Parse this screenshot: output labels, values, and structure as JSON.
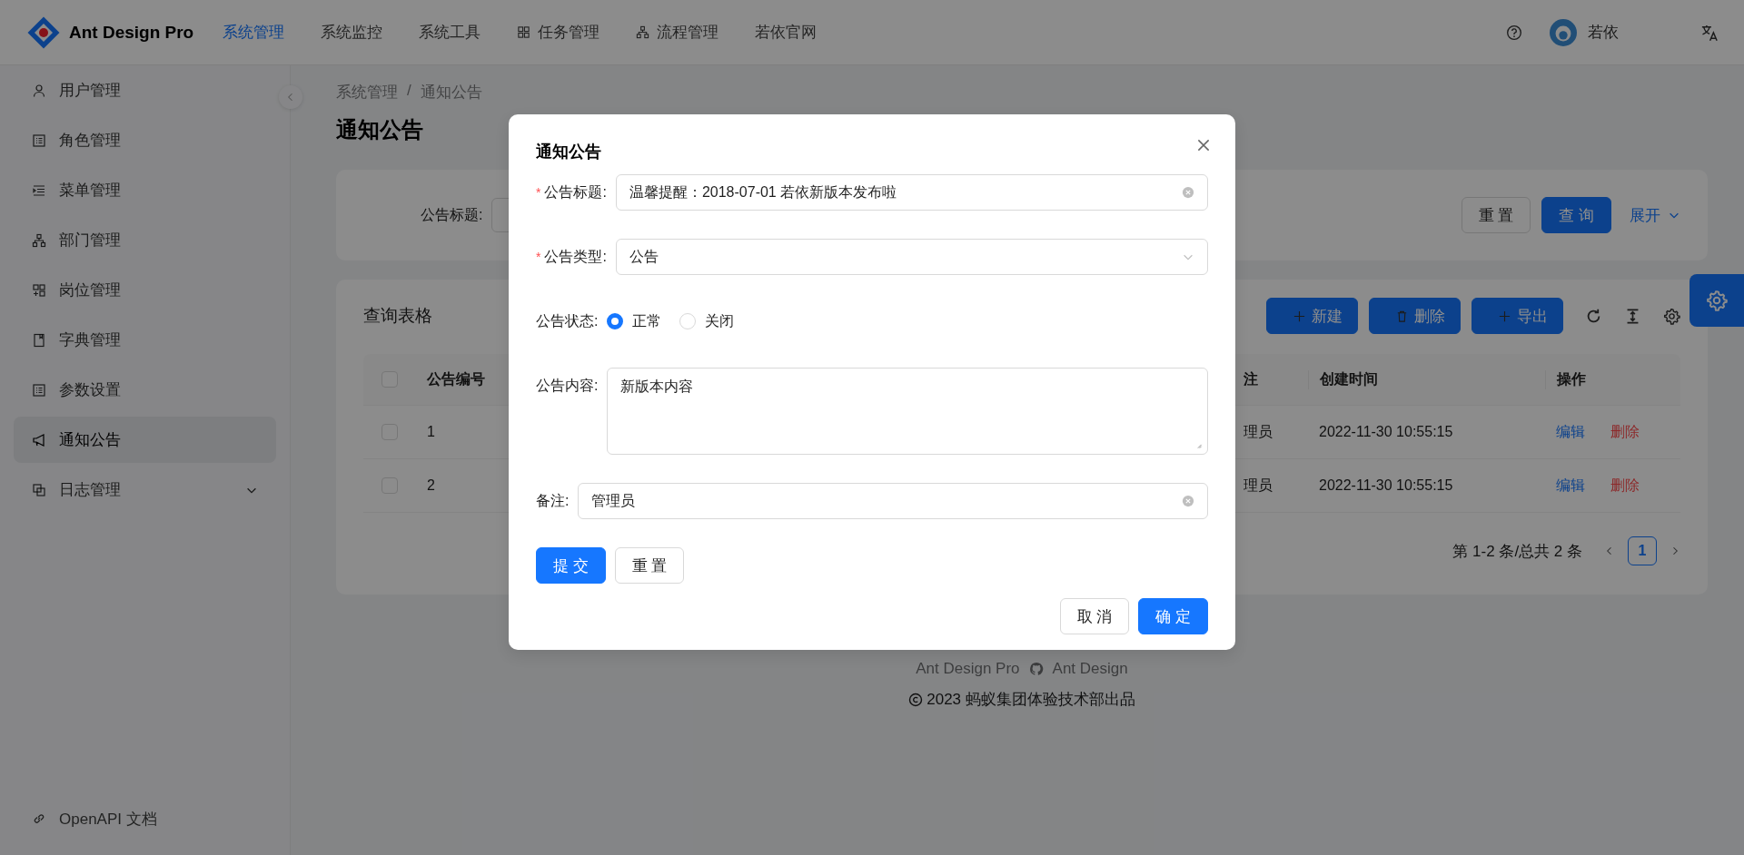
{
  "header": {
    "logo_text": "Ant Design Pro",
    "menu": [
      {
        "label": "系统管理",
        "selected": true
      },
      {
        "label": "系统监控",
        "selected": false
      },
      {
        "label": "系统工具",
        "selected": false
      },
      {
        "label": "任务管理",
        "selected": false,
        "kind": "grid"
      },
      {
        "label": "流程管理",
        "selected": false,
        "kind": "tree"
      },
      {
        "label": "若依官网",
        "selected": false
      }
    ],
    "user_name": "若依"
  },
  "sidebar": {
    "items": [
      {
        "label": "用户管理",
        "selected": false
      },
      {
        "label": "角色管理",
        "selected": false
      },
      {
        "label": "菜单管理",
        "selected": false
      },
      {
        "label": "部门管理",
        "selected": false
      },
      {
        "label": "岗位管理",
        "selected": false
      },
      {
        "label": "字典管理",
        "selected": false
      },
      {
        "label": "参数设置",
        "selected": false
      },
      {
        "label": "通知公告",
        "selected": true
      },
      {
        "label": "日志管理",
        "selected": false,
        "expanded": false
      }
    ],
    "footer_link": "OpenAPI 文档"
  },
  "breadcrumb": [
    "系统管理",
    "通知公告"
  ],
  "breadcrumb_separator": "/",
  "page_title": "通知公告",
  "search": {
    "label": "公告标题:",
    "buttons": [
      {
        "label": "重 置",
        "primary": false
      },
      {
        "label": "查 询",
        "primary": true
      }
    ],
    "expand": "展开"
  },
  "table": {
    "title": "查询表格",
    "toolbar": [
      {
        "label": "新建"
      },
      {
        "label": "删除"
      },
      {
        "label": "导出"
      }
    ],
    "header_checked": false,
    "columns": [
      "公告编号",
      "注",
      "创建时间",
      "操作"
    ],
    "rows": [
      {
        "checked": false,
        "no": "1",
        "remark": "理员",
        "created": "2022-11-30 10:55:15",
        "actions": [
          "编辑",
          "删除"
        ]
      },
      {
        "checked": false,
        "no": "2",
        "remark": "理员",
        "created": "2022-11-30 10:55:15",
        "actions": [
          "编辑",
          "删除"
        ]
      }
    ],
    "pagination": {
      "summary": "第 1-2 条/总共 2 条",
      "pages": [
        {
          "label": "1",
          "selected": true
        }
      ]
    }
  },
  "modal": {
    "title": "通知公告",
    "required_mark": "*",
    "fields": [
      {
        "kind": "input",
        "label": "公告标题:",
        "required": true,
        "value": "温馨提醒：2018-07-01 若依新版本发布啦"
      },
      {
        "kind": "select",
        "label": "公告类型:",
        "required": true,
        "value": "公告"
      },
      {
        "kind": "radio",
        "label": "公告状态:",
        "required": false,
        "options": [
          {
            "label": "正常",
            "selected": true
          },
          {
            "label": "关闭",
            "selected": false
          }
        ]
      },
      {
        "kind": "textarea",
        "label": "公告内容:",
        "required": false,
        "value": "新版本内容"
      },
      {
        "kind": "input",
        "label": "备注:",
        "required": false,
        "value": "管理员"
      }
    ],
    "form_buttons": [
      {
        "label": "提 交",
        "primary": true
      },
      {
        "label": "重 置",
        "primary": false
      }
    ],
    "footer_buttons": [
      {
        "label": "取 消",
        "primary": false
      },
      {
        "label": "确 定",
        "primary": true
      }
    ]
  },
  "footer": {
    "links": [
      "Ant Design Pro",
      "Ant Design"
    ],
    "copyright": "2023 蚂蚁集团体验技术部出品"
  }
}
